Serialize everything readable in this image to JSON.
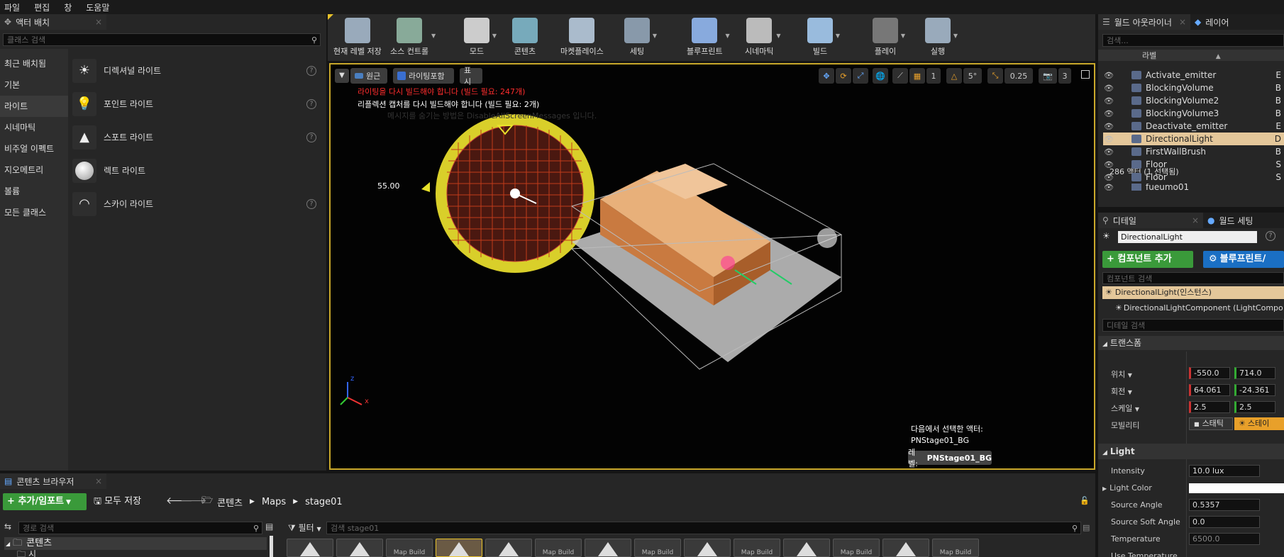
{
  "menu": [
    "파일",
    "편집",
    "창",
    "도움말"
  ],
  "place_actors": {
    "tab_title": "액터 배치",
    "search_placeholder": "클래스 검색",
    "categories": [
      "최근 배치됨",
      "기본",
      "라이트",
      "시네마틱",
      "비주얼 이펙트",
      "지오메트리",
      "볼륨",
      "모든 클래스"
    ],
    "selected_category": "라이트",
    "items": [
      {
        "label": "디렉셔널 라이트",
        "icon": "directional-light-icon"
      },
      {
        "label": "포인트 라이트",
        "icon": "point-light-icon"
      },
      {
        "label": "스포트 라이트",
        "icon": "spot-light-icon"
      },
      {
        "label": "렉트 라이트",
        "icon": "rect-light-icon"
      },
      {
        "label": "스카이 라이트",
        "icon": "sky-light-icon"
      }
    ]
  },
  "toolbar": {
    "buttons": [
      {
        "label": "현재 레벨 저장",
        "icon": "save-icon",
        "color": "#9ab"
      },
      {
        "label": "소스 컨트롤",
        "icon": "source-control-icon",
        "color": "#8a9"
      },
      {
        "label": "모드",
        "icon": "modes-icon",
        "color": "#ccc"
      },
      {
        "label": "콘텐츠",
        "icon": "content-icon",
        "color": "#7ab"
      },
      {
        "label": "마켓플레이스",
        "icon": "marketplace-icon",
        "color": "#abc"
      },
      {
        "label": "세팅",
        "icon": "settings-icon",
        "color": "#89a"
      },
      {
        "label": "블루프린트",
        "icon": "blueprint-icon",
        "color": "#8ad"
      },
      {
        "label": "시네마틱",
        "icon": "cinematics-icon",
        "color": "#bbb"
      },
      {
        "label": "빌드",
        "icon": "build-icon",
        "color": "#9bd"
      },
      {
        "label": "플레이",
        "icon": "play-icon",
        "color": "#777"
      },
      {
        "label": "실행",
        "icon": "launch-icon",
        "color": "#9ab"
      }
    ]
  },
  "viewport": {
    "perspective": "원근",
    "lit": "라이팅포함",
    "show": "표시",
    "grid_snap": "1",
    "rot_snap": "5°",
    "scale_snap": "0.25",
    "cam_speed": "3",
    "msg_lighting": "라이팅을 다시 빌드해야 합니다 (빌드 필요: 247개)",
    "msg_reflection": "리플렉션 캡처를 다시 빌드해야 합니다 (빌드 필요: 2개)",
    "msg_hide": "메시지를 숨기는 방법은 DisableAllScreenMessages 입니다.",
    "angle_value": "55.00",
    "selected_actor_label": "다음에서 선택한 액터:",
    "selected_actor": "PNStage01_BG",
    "level_label": "레벨:",
    "level_name": "PNStage01_BG",
    "axis_z": "z",
    "axis_x": "x",
    "message_colors": {
      "warning": "#ff2d2d",
      "info": "#ffffff"
    }
  },
  "outliner": {
    "tabs": [
      "월드 아웃라이너",
      "레이어"
    ],
    "search_placeholder": "검색...",
    "col_label": "라벨",
    "rows": [
      {
        "name": "Activate_emitter",
        "type": "E"
      },
      {
        "name": "BlockingVolume",
        "type": "B"
      },
      {
        "name": "BlockingVolume2",
        "type": "B"
      },
      {
        "name": "BlockingVolume3",
        "type": "B"
      },
      {
        "name": "Deactivate_emitter",
        "type": "E"
      },
      {
        "name": "DirectionalLight",
        "type": "D",
        "selected": true
      },
      {
        "name": "FirstWallBrush",
        "type": "B"
      },
      {
        "name": "Floor",
        "type": "S"
      },
      {
        "name": "Floor",
        "type": "S"
      },
      {
        "name": "fueumo01",
        "type": ""
      }
    ],
    "count": "286 액터 (1 선택됨)"
  },
  "details": {
    "tabs": [
      "디테일",
      "월드 세팅"
    ],
    "name_value": "DirectionalLight",
    "add_component": "+ 컴포넌트 추가",
    "blueprint": "블루프린트/",
    "comp_search": "컴포넌트 검색",
    "instance": "DirectionalLight(인스턴스)",
    "component": "DirectionalLightComponent (LightCompo",
    "detail_search": "디테일 검색",
    "transform_header": "트랜스폼",
    "transform": [
      {
        "label": "위치",
        "x": "-550.0",
        "y": "714.0"
      },
      {
        "label": "회전",
        "x": "64.061",
        "y": "-24.361"
      },
      {
        "label": "스케일",
        "x": "2.5",
        "y": "2.5"
      }
    ],
    "mobility_label": "모빌리티",
    "mobility_static": "스태틱",
    "mobility_stationary": "스테이",
    "light_header": "Light",
    "light_props": [
      {
        "label": "Intensity",
        "value": "10.0 lux"
      },
      {
        "label": "Light Color",
        "value": ""
      },
      {
        "label": "Source Angle",
        "value": "0.5357"
      },
      {
        "label": "Source Soft Angle",
        "value": "0.0"
      },
      {
        "label": "Temperature",
        "value": "6500.0"
      },
      {
        "label": "Use Temperature",
        "value": ""
      }
    ]
  },
  "content_browser": {
    "tab_title": "콘텐츠 브라우저",
    "add_import": "추가/임포트",
    "save_all": "모두 저장",
    "path": [
      "콘텐츠",
      "Maps",
      "stage01"
    ],
    "path_search": "경로 검색",
    "filter": "필터",
    "asset_search": "검색 stage01",
    "tree_root": "콘텐츠",
    "tree_child": "시",
    "assets": [
      "",
      "",
      "Map Build",
      "",
      "",
      "Map Build",
      "",
      "Map Build",
      "",
      "Map Build",
      "",
      "Map Build",
      "",
      "Map Build"
    ]
  },
  "colors": {
    "accent_yellow": "#e8c22a",
    "selected_row": "#e4c79a",
    "add_green": "#3a9a3a",
    "blueprint_blue": "#1a6fc4"
  }
}
